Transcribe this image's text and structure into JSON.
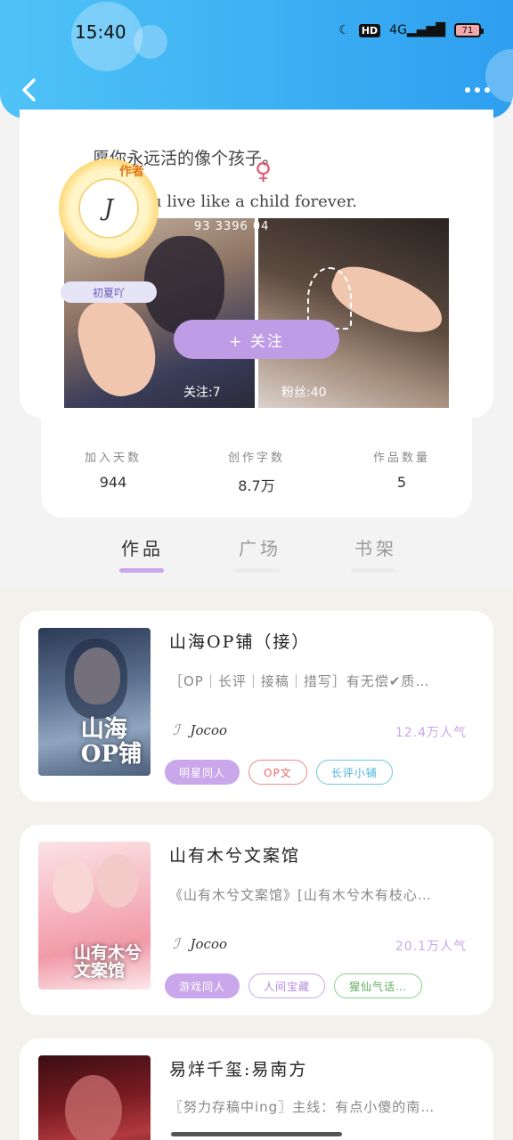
{
  "status_bar": {
    "time": "15:40",
    "hd": "HD",
    "network": "4G",
    "battery": "71"
  },
  "nav": {
    "back_icon": "back-chevron-icon",
    "more_icon": "more-dots-icon"
  },
  "profile": {
    "quote_cn": "愿你永远活的像个孩子。",
    "quote_en": "u live like a child forever.",
    "id_text": "93 3396 04",
    "author_badge": "作者",
    "avatar_text": "J",
    "nickname_tag": "初夏吖",
    "follow_button": "+ 关注",
    "following_count": "关注:7",
    "fans_count": "粉丝:40"
  },
  "stats": [
    {
      "label": "加入天数",
      "value": "944"
    },
    {
      "label": "创作字数",
      "value": "8.7万"
    },
    {
      "label": "作品数量",
      "value": "5"
    }
  ],
  "tabs": [
    {
      "label": "作品",
      "active": true
    },
    {
      "label": "广场",
      "active": false
    },
    {
      "label": "书架",
      "active": false
    }
  ],
  "works": [
    {
      "title": "山海OP铺（接）",
      "cover_title": "山海\nOP铺",
      "description": "［OP｜长评｜接稿｜措写］有无偿✔质…",
      "author": "Jocoo",
      "popularity": "12.4万人气",
      "tags": [
        "明星同人",
        "OP文",
        "长评小铺"
      ]
    },
    {
      "title": "山有木兮文案馆",
      "cover_title": "山有木兮\n文案馆",
      "description": "《山有木兮文案馆》[山有木兮木有枝心…",
      "author": "Jocoo",
      "popularity": "20.1万人气",
      "tags": [
        "游戏同人",
        "人间宝藏",
        "猩仙气话…"
      ]
    },
    {
      "title": "易烊千玺:易南方",
      "description": "〖努力存稿中ing〗主线：有点小傻的南…"
    }
  ]
}
